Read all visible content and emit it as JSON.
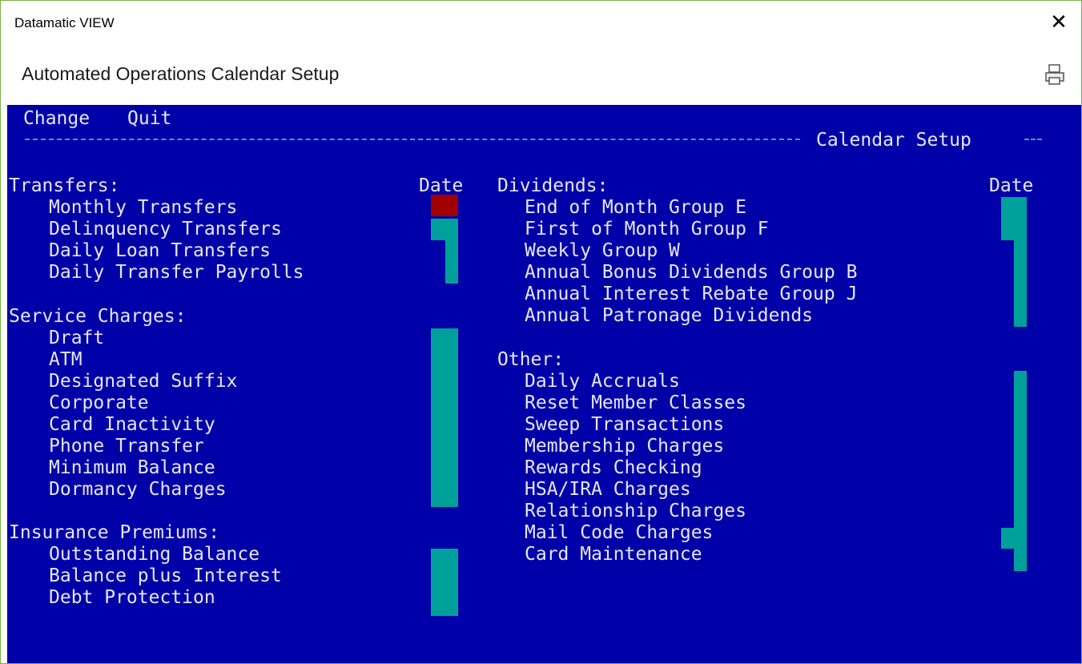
{
  "window": {
    "app_title": "Datamatic VIEW",
    "close_glyph": "✕",
    "subtitle": "Automated Operations Calendar Setup",
    "print_icon": "printer-icon"
  },
  "menu": {
    "change": "Change",
    "quit": "Quit",
    "screen_title": "Calendar Setup"
  },
  "left": {
    "date_header": "Date",
    "transfers": {
      "heading": "Transfers:",
      "items": [
        "Monthly Transfers",
        "Delinquency Transfers",
        "Daily Loan Transfers",
        "Daily Transfer Payrolls"
      ]
    },
    "service_charges": {
      "heading": "Service Charges:",
      "items": [
        "Draft",
        "ATM",
        "Designated Suffix",
        "Corporate",
        "Card Inactivity",
        "Phone Transfer",
        "Minimum Balance",
        "Dormancy Charges"
      ]
    },
    "insurance": {
      "heading": "Insurance Premiums:",
      "items": [
        "Outstanding Balance",
        "Balance plus Interest",
        "Debt Protection"
      ]
    }
  },
  "right": {
    "date_header": "Date",
    "dividends": {
      "heading": "Dividends:",
      "items": [
        "End of Month Group E",
        "First of Month Group F",
        "Weekly Group W",
        "Annual Bonus Dividends Group B",
        "Annual Interest Rebate Group J",
        "Annual Patronage Dividends"
      ]
    },
    "other": {
      "heading": "Other:",
      "items": [
        "Daily Accruals",
        "Reset Member Classes",
        "Sweep Transactions",
        "Membership Charges",
        "Rewards Checking",
        "HSA/IRA Charges",
        "Relationship Charges",
        "Mail Code Charges",
        "Card Maintenance"
      ]
    }
  },
  "colors": {
    "terminal_bg": "#0000a8",
    "field": "#00a09a",
    "active_field": "#a00000",
    "rule": "#2aa8d8",
    "text": "#e6e6f2"
  }
}
